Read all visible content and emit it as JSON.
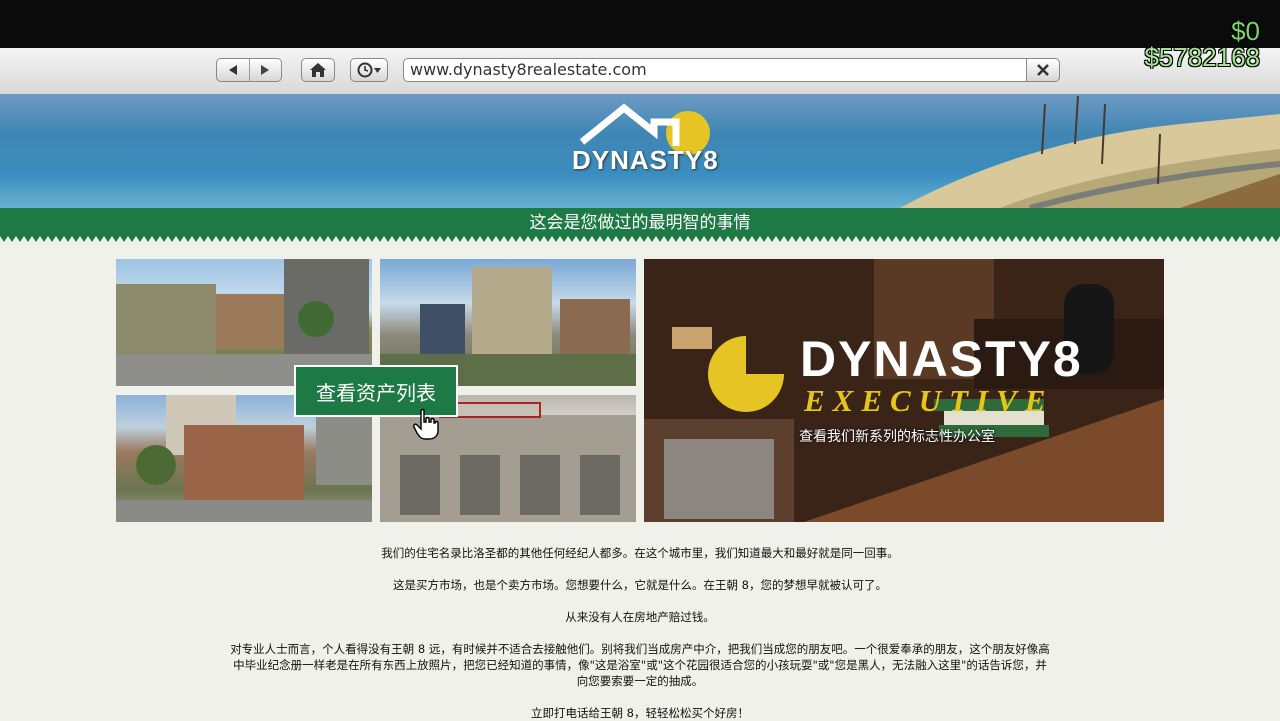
{
  "hud": {
    "cash": "$0",
    "bank": "$5782168"
  },
  "browser": {
    "url": "www.dynasty8realestate.com"
  },
  "logo": {
    "text": "DYNASTY8"
  },
  "tagline": "这会是您做过的最明智的事情",
  "cta": {
    "label": "查看资产列表"
  },
  "executive": {
    "title": "DYNASTY8",
    "subtitle": "EXECUTIVE",
    "caption": "查看我们新系列的标志性办公室"
  },
  "paragraphs": [
    "我们的住宅名录比洛圣都的其他任何经纪人都多。在这个城市里，我们知道最大和最好就是同一回事。",
    "这是买方市场，也是个卖方市场。您想要什么，它就是什么。在王朝 8，您的梦想早就被认可了。",
    "从来没有人在房地产赔过钱。",
    "对专业人士而言，个人看得没有王朝 8 远，有时候并不适合去接触他们。别将我们当成房产中介，把我们当成您的朋友吧。一个很爱奉承的朋友，这个朋友好像高中毕业纪念册一样老是在所有东西上放照片，把您已经知道的事情，像\"这是浴室\"或\"这个花园很适合您的小孩玩耍\"或\"您是黑人，无法融入这里\"的话告诉您，并向您要索要一定的抽成。",
    "立即打电话给王朝 8，轻轻松松买个好房！"
  ]
}
